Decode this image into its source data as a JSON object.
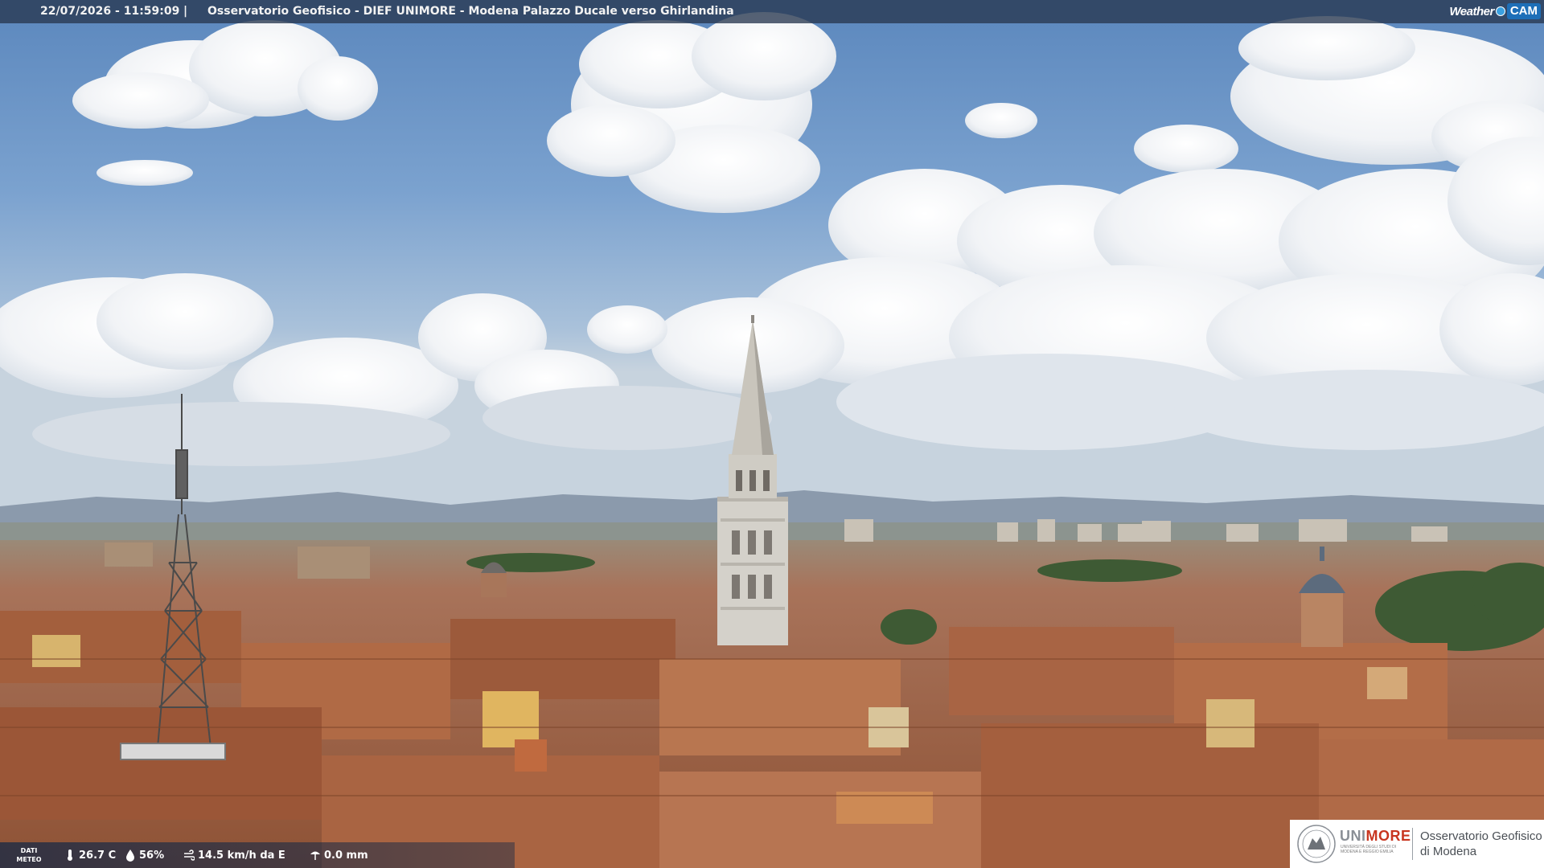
{
  "overlay": {
    "timestamp": "22/07/2026 - 11:59:09",
    "separator": "|",
    "caption": "Osservatorio Geofisico - DIEF UNIMORE - Modena Palazzo Ducale verso Ghirlandina",
    "logo_weather": "Weather",
    "logo_cam": "CAM"
  },
  "meteo": {
    "label": "DATI METEO",
    "temperature": "26.7 C",
    "humidity": "56%",
    "wind": "14.5 km/h da E",
    "rain": "0.0 mm",
    "icons": [
      "thermometer-icon",
      "humidity-icon",
      "wind-icon",
      "rain-icon"
    ]
  },
  "branding": {
    "university_grey": "UNI",
    "university_red": "MORE",
    "university_sub": "Università degli studi di Modena e Reggio Emilia",
    "observatory_line1": "Osservatorio Geofisico",
    "observatory_line2": "di Modena"
  },
  "colors": {
    "sky": "#6f9bc9",
    "roofs": "#b06a45",
    "unimore_red": "#c8351f",
    "weathercam_blue": "#1e6fb8"
  }
}
